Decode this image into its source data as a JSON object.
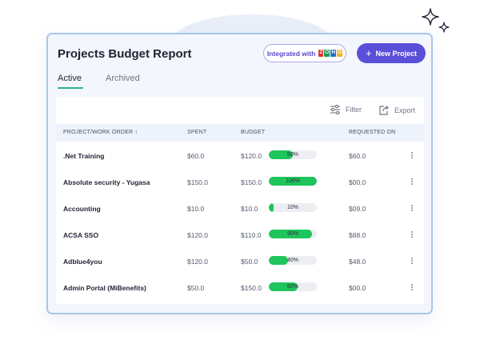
{
  "report": {
    "title": "Projects Budget Report",
    "integrated_label": "Integrated with",
    "zoho_letters": [
      {
        "char": "Z",
        "color": "#e0322b"
      },
      {
        "char": "O",
        "color": "#1b9c4c"
      },
      {
        "char": "H",
        "color": "#2470c6"
      },
      {
        "char": "O",
        "color": "#f0b51f"
      }
    ],
    "new_project_label": "New Project"
  },
  "tabs": [
    {
      "label": "Active",
      "active": true
    },
    {
      "label": "Archived",
      "active": false
    }
  ],
  "toolbar": {
    "filter_label": "Filter",
    "export_label": "Export"
  },
  "table": {
    "columns": {
      "project": "PROJECT/WORK ORDER ↑",
      "spent": "SPENT",
      "budget": "BUDGET",
      "requested": "REQUESTED ON"
    },
    "rows": [
      {
        "name": ".Net Training",
        "spent": "$60.0",
        "budget": "$120.0",
        "percent_label": "50%",
        "percent": 50,
        "requested": "$60.0"
      },
      {
        "name": "Absolute security - Yugasa",
        "spent": "$150.0",
        "budget": "$150.0",
        "percent_label": "100%",
        "percent": 100,
        "requested": "$00.0"
      },
      {
        "name": "Accounting",
        "spent": "$10.0",
        "budget": "$10.0",
        "percent_label": "10%",
        "percent": 10,
        "requested": "$09.0"
      },
      {
        "name": "ACSA SSO",
        "spent": "$120.0",
        "budget": "$110.0",
        "percent_label": "90%",
        "percent": 90,
        "requested": "$88.0"
      },
      {
        "name": "Adblue4you",
        "spent": "$120.0",
        "budget": "$50.0",
        "percent_label": "40%",
        "percent": 40,
        "requested": "$48.0"
      },
      {
        "name": "Admin Portal (MiBenefits)",
        "spent": "$50.0",
        "budget": "$150.0",
        "percent_label": "60%",
        "percent": 60,
        "requested": "$00.0"
      }
    ]
  },
  "colors": {
    "accent": "#5a4fd8",
    "progress": "#1ec45c",
    "tab_underline": "#2bb38a"
  }
}
